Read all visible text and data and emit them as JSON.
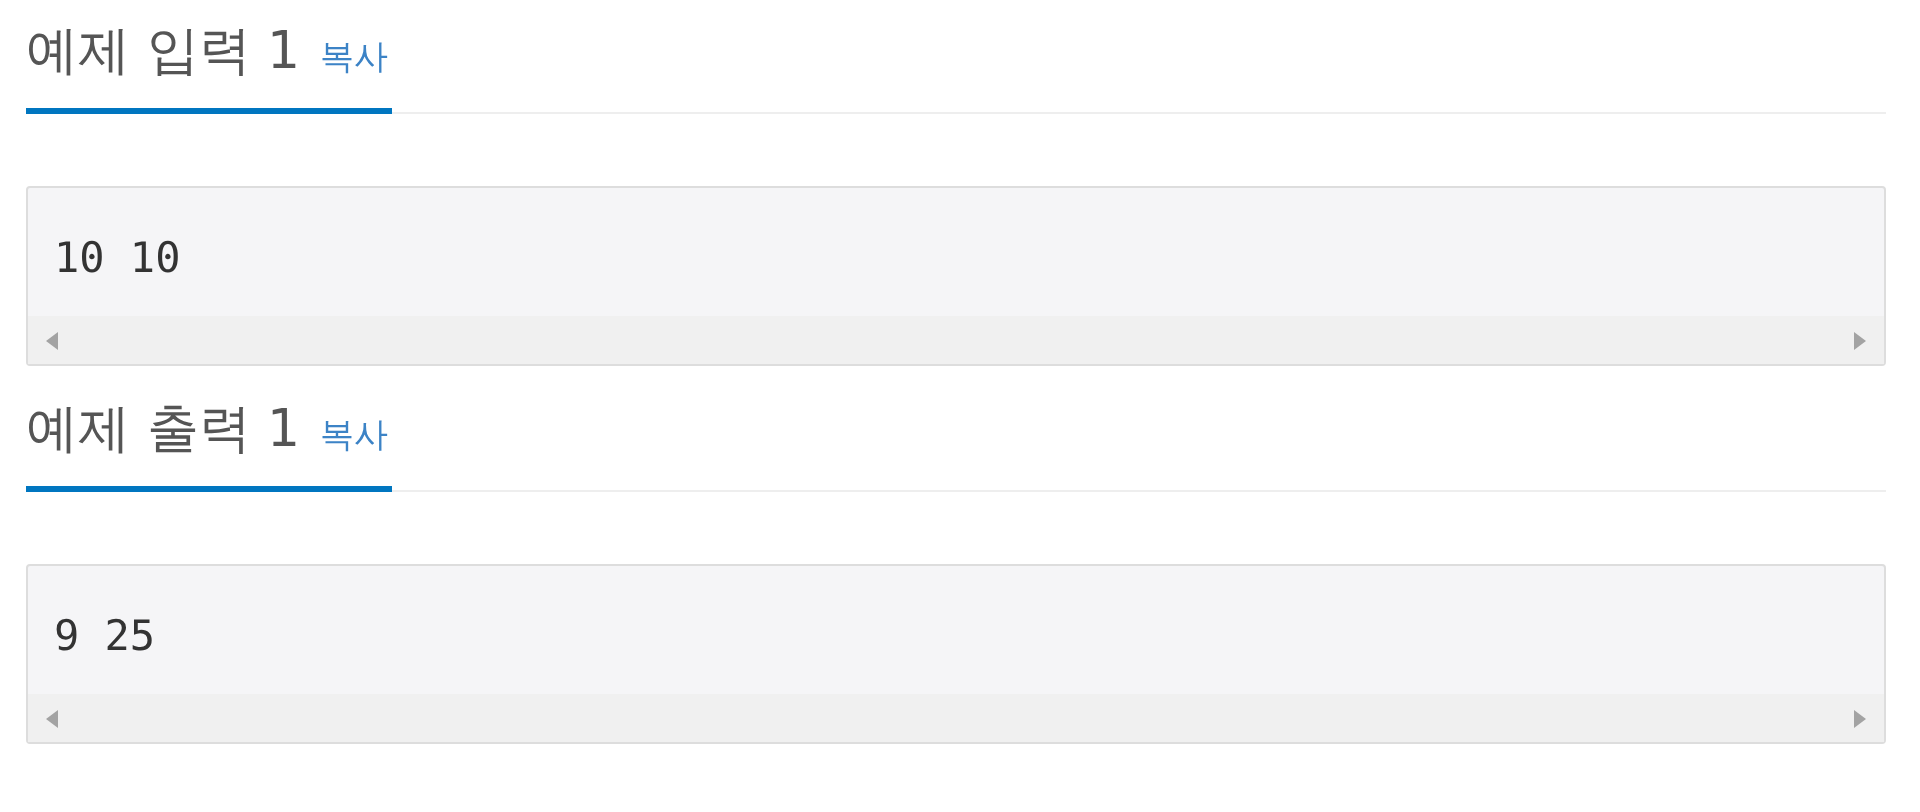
{
  "sections": [
    {
      "title": "예제 입력 1",
      "copy": "복사",
      "content": "10 10"
    },
    {
      "title": "예제 출력 1",
      "copy": "복사",
      "content": "9 25"
    }
  ]
}
